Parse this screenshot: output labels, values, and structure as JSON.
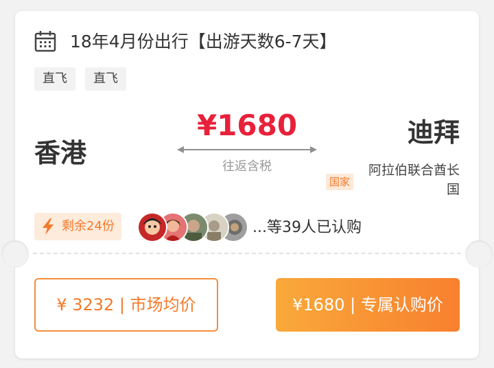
{
  "trip": {
    "date_title": "18年4月份出行【出游天数6-7天】",
    "tags": [
      "直飞",
      "直飞"
    ]
  },
  "route": {
    "from": "香港",
    "to": "迪拜",
    "price": "¥1680",
    "price_note": "往返含税",
    "country_badge": "国家",
    "country_name": "阿拉伯联合酋长国"
  },
  "social": {
    "stock_text": "剩余24份",
    "buyers_text": "...等39人已认购",
    "avatar_count": 5
  },
  "actions": {
    "market_price": "¥ 3232 | 市场均价",
    "exclusive_price": "¥1680 | 专属认购价"
  },
  "colors": {
    "price_red": "#e8213a",
    "accent_orange": "#f47a2a",
    "button_gradient_start": "#f9a93a",
    "button_gradient_end": "#f8802f"
  },
  "icons": {
    "calendar": "calendar-icon",
    "bolt": "lightning-icon",
    "arrow": "two-way-arrow-icon"
  }
}
